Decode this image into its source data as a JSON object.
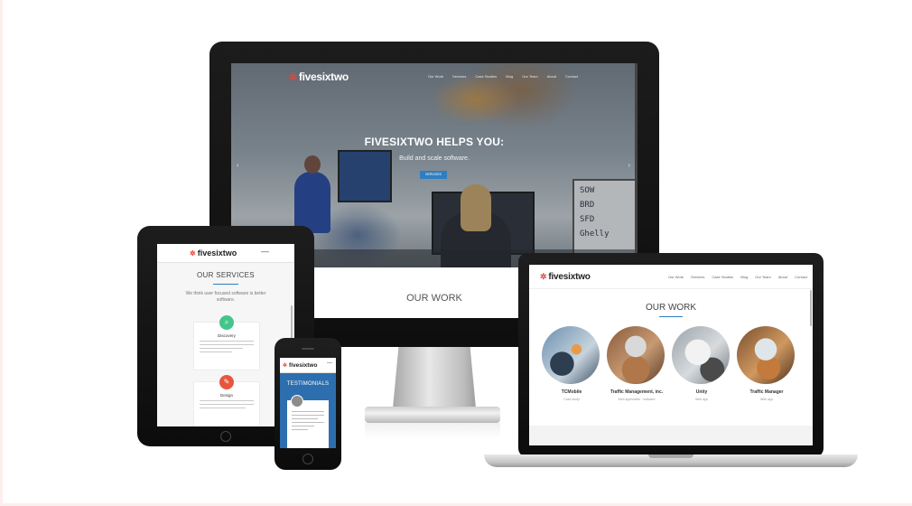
{
  "brand": {
    "name": "fivesixtwo",
    "accent": "#2f7fc0",
    "logo_red": "#e2463a"
  },
  "imac": {
    "nav": [
      "Our Work",
      "Services",
      "Case Studies",
      "Blog",
      "Our Team",
      "About",
      "Contact"
    ],
    "hero_title": "FIVESIXTWO HELPS YOU:",
    "hero_subtitle": "Build and scale software.",
    "hero_button": "SERVICES",
    "arrow_prev": "‹",
    "arrow_next": "›",
    "board_lines": [
      "SOW",
      "BRD",
      "SFD",
      "Ghelly"
    ],
    "section_title": "OUR WORK"
  },
  "tablet": {
    "menu_glyph": "—",
    "section_title": "OUR SERVICES",
    "section_subtitle": "We think user focused software is better software.",
    "cards": [
      {
        "title": "Discovery",
        "badge_color": "#44c58a",
        "icon": "search-icon"
      },
      {
        "title": "Design",
        "badge_color": "#e8553f",
        "icon": "pencil-icon"
      }
    ]
  },
  "phone": {
    "menu_glyph": "—",
    "section_title": "TESTIMONIALS"
  },
  "laptop": {
    "nav": [
      "Our Work",
      "Services",
      "Case Studies",
      "Blog",
      "Our Team",
      "About",
      "Contact"
    ],
    "section_title": "OUR WORK",
    "work": [
      {
        "name": "TCMobile",
        "category": "Case study"
      },
      {
        "name": "Traffic Management, inc.",
        "category": "Web application · software"
      },
      {
        "name": "Unity",
        "category": "Web app"
      },
      {
        "name": "Traffic Manager",
        "category": "Web app"
      }
    ]
  }
}
